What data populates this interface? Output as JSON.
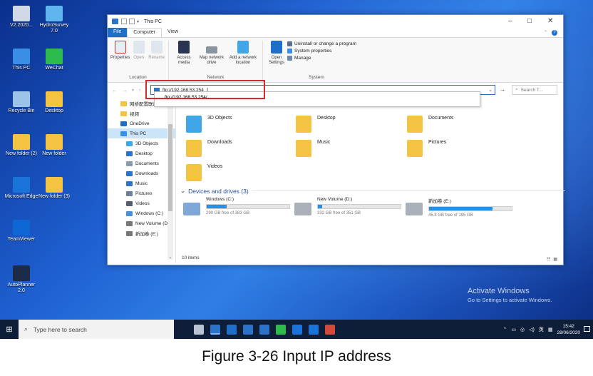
{
  "desktop": {
    "icons": [
      {
        "label": "V2.2020...",
        "color": "#cfd8e6"
      },
      {
        "label": "HydroSurvey 7.0",
        "color": "#5fb6ef"
      },
      {
        "label": "This PC",
        "color": "#3a8ee6"
      },
      {
        "label": "WeChat",
        "color": "#2dbb4e"
      },
      {
        "label": "Recycle Bin",
        "color": "#9cc3e8"
      },
      {
        "label": "Desktop",
        "color": "#f5c342"
      },
      {
        "label": "New folder (2)",
        "color": "#f5c342"
      },
      {
        "label": "New folder",
        "color": "#f5c342"
      },
      {
        "label": "Microsoft Edge",
        "color": "#1a73d8"
      },
      {
        "label": "New folder (3)",
        "color": "#f5c342"
      },
      {
        "label": "TeamViewer",
        "color": "#0e67d3"
      },
      {
        "label": "AutoPlanner 2.0",
        "color": "#1c2c48"
      }
    ]
  },
  "window": {
    "title": "This PC",
    "tabs": {
      "file": "File",
      "computer": "Computer",
      "view": "View"
    },
    "ribbon": {
      "location": {
        "label": "Location",
        "properties": "Properties",
        "open": "Open",
        "rename": "Rename"
      },
      "network": {
        "label": "Network",
        "access_media": "Access media",
        "map_drive": "Map network drive",
        "add_location": "Add a network location"
      },
      "system": {
        "label": "System",
        "open_settings": "Open Settings",
        "uninstall": "Uninstall or change a program",
        "sys_props": "System properties",
        "manage": "Manage"
      }
    },
    "address": {
      "value": "ftp://192.168.53.254",
      "suggestion": "ftp://192.168.53.254/",
      "search_placeholder": "Search T..."
    },
    "nav": {
      "items": [
        {
          "label": "网桥配置联动",
          "color": "#f5c342"
        },
        {
          "label": "视频",
          "color": "#f5c342"
        },
        {
          "label": "OneDrive",
          "color": "#1f6fc9"
        },
        {
          "label": "This PC",
          "color": "#3a8ee6"
        },
        {
          "label": "3D Objects",
          "color": "#3fa7e8"
        },
        {
          "label": "Desktop",
          "color": "#2b72c8"
        },
        {
          "label": "Documents",
          "color": "#8a9bb0"
        },
        {
          "label": "Downloads",
          "color": "#2b72c8"
        },
        {
          "label": "Music",
          "color": "#2b72c8"
        },
        {
          "label": "Pictures",
          "color": "#6b7f96"
        },
        {
          "label": "Videos",
          "color": "#555e6b"
        },
        {
          "label": "Windows (C:)",
          "color": "#4a8fd8"
        },
        {
          "label": "New Volume (D:",
          "color": "#777777"
        },
        {
          "label": "新加卷 (E:)",
          "color": "#777777"
        }
      ]
    },
    "folders": [
      {
        "label": "3D Objects",
        "color": "#3fa7e8"
      },
      {
        "label": "Desktop",
        "color": "#f5c342"
      },
      {
        "label": "Documents",
        "color": "#f5c342"
      },
      {
        "label": "Downloads",
        "color": "#f5c342"
      },
      {
        "label": "Music",
        "color": "#f5c342"
      },
      {
        "label": "Pictures",
        "color": "#f5c342"
      },
      {
        "label": "Videos",
        "color": "#f5c342"
      }
    ],
    "drives_header": "Devices and drives (3)",
    "drives": [
      {
        "name": "Windows (C:)",
        "free": "290 GB free of 383 GB",
        "used_fraction": 0.24
      },
      {
        "name": "New Volume (D:)",
        "free": "332 GB free of 351 GB",
        "used_fraction": 0.05
      },
      {
        "name": "新加卷 (E:)",
        "free": "45.8 GB free of 195 GB",
        "used_fraction": 0.77
      }
    ],
    "status": "10 items"
  },
  "activation": {
    "title": "Activate Windows",
    "subtitle": "Go to Settings to activate Windows."
  },
  "taskbar": {
    "search_placeholder": "Type here to search",
    "app_colors": [
      "#b9c3d3",
      "#2b72c8",
      "#1f6fc9",
      "#2b72c8",
      "#2b72c8",
      "#2dbb4e",
      "#1a73d8",
      "#1a73d8",
      "#d24a3a"
    ],
    "tray": {
      "lang": "英",
      "time": "15:42",
      "date": "28/06/2020"
    }
  },
  "caption": "Figure 3-26 Input IP address"
}
